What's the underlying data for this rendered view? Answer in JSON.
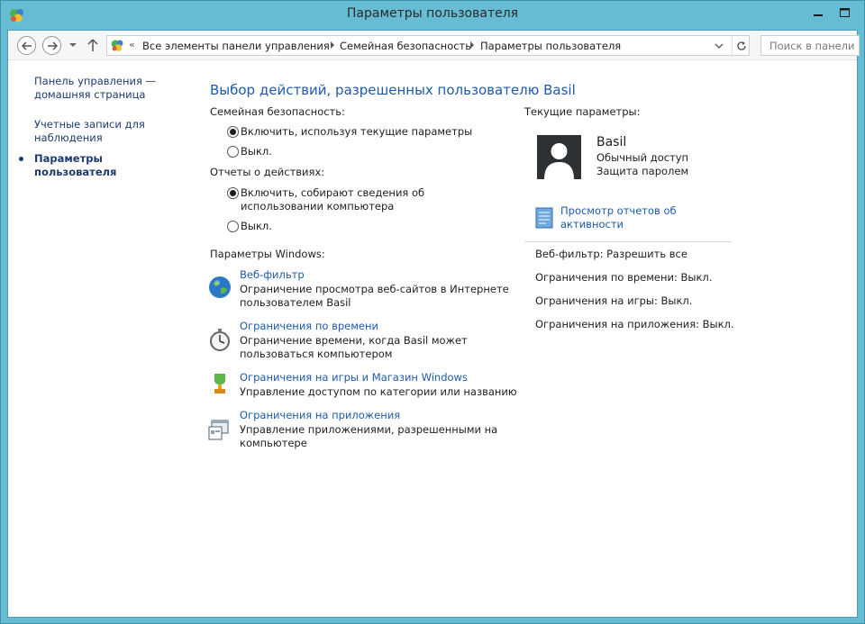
{
  "window": {
    "title": "Параметры пользователя",
    "frame_color": "#66bcd3",
    "accent_link_color": "#1e5aa8"
  },
  "titlebar_icons": {
    "app": "control-panel-icon",
    "minimize": "minimize-icon",
    "maximize": "maximize-icon"
  },
  "navbar": {
    "back": "back-arrow-icon",
    "forward": "forward-arrow-icon",
    "recent": "chevron-down-icon",
    "up": "up-arrow-icon",
    "breadcrumb_overflow": "«",
    "crumbs": [
      "Все элементы панели управления",
      "Семейная безопасность",
      "Параметры пользователя"
    ],
    "refresh": "refresh-icon",
    "search_placeholder": "Поиск в панели ..."
  },
  "sidebar": {
    "home": "Панель управления — домашняя страница",
    "accounts": "Учетные записи для наблюдения",
    "current": "Параметры пользователя"
  },
  "main": {
    "heading": "Выбор действий, разрешенных пользователю Basil",
    "family_safety": {
      "label": "Семейная безопасность:",
      "options": [
        {
          "text": "Включить, используя текущие параметры",
          "selected": true
        },
        {
          "text": "Выкл.",
          "selected": false
        }
      ]
    },
    "activity_reports": {
      "label": "Отчеты о действиях:",
      "options": [
        {
          "text": "Включить, собирают сведения об использовании компьютера",
          "selected": true
        },
        {
          "text": "Выкл.",
          "selected": false
        }
      ]
    },
    "windows_settings": {
      "label": "Параметры Windows:",
      "items": [
        {
          "icon": "globe-icon",
          "title": "Веб-фильтр",
          "desc": "Ограничение просмотра веб-сайтов в Интернете пользователем Basil"
        },
        {
          "icon": "stopwatch-icon",
          "title": "Ограничения по времени",
          "desc": "Ограничение времени, когда Basil может пользоваться компьютером"
        },
        {
          "icon": "trophy-icon",
          "title": "Ограничения на игры и Магазин Windows",
          "desc": "Управление доступом по категории или названию"
        },
        {
          "icon": "app-window-icon",
          "title": "Ограничения на приложения",
          "desc": "Управление приложениями, разрешенными на компьютере"
        }
      ]
    }
  },
  "current": {
    "label": "Текущие параметры:",
    "user": {
      "name": "Basil",
      "account_type": "Обычный доступ",
      "password": "Защита паролем"
    },
    "report_link": "Просмотр отчетов об активности",
    "statuses": [
      "Веб-фильтр: Разрешить все",
      "Ограничения по времени: Выкл.",
      "Ограничения на игры: Выкл.",
      "Ограничения на приложения: Выкл."
    ]
  }
}
